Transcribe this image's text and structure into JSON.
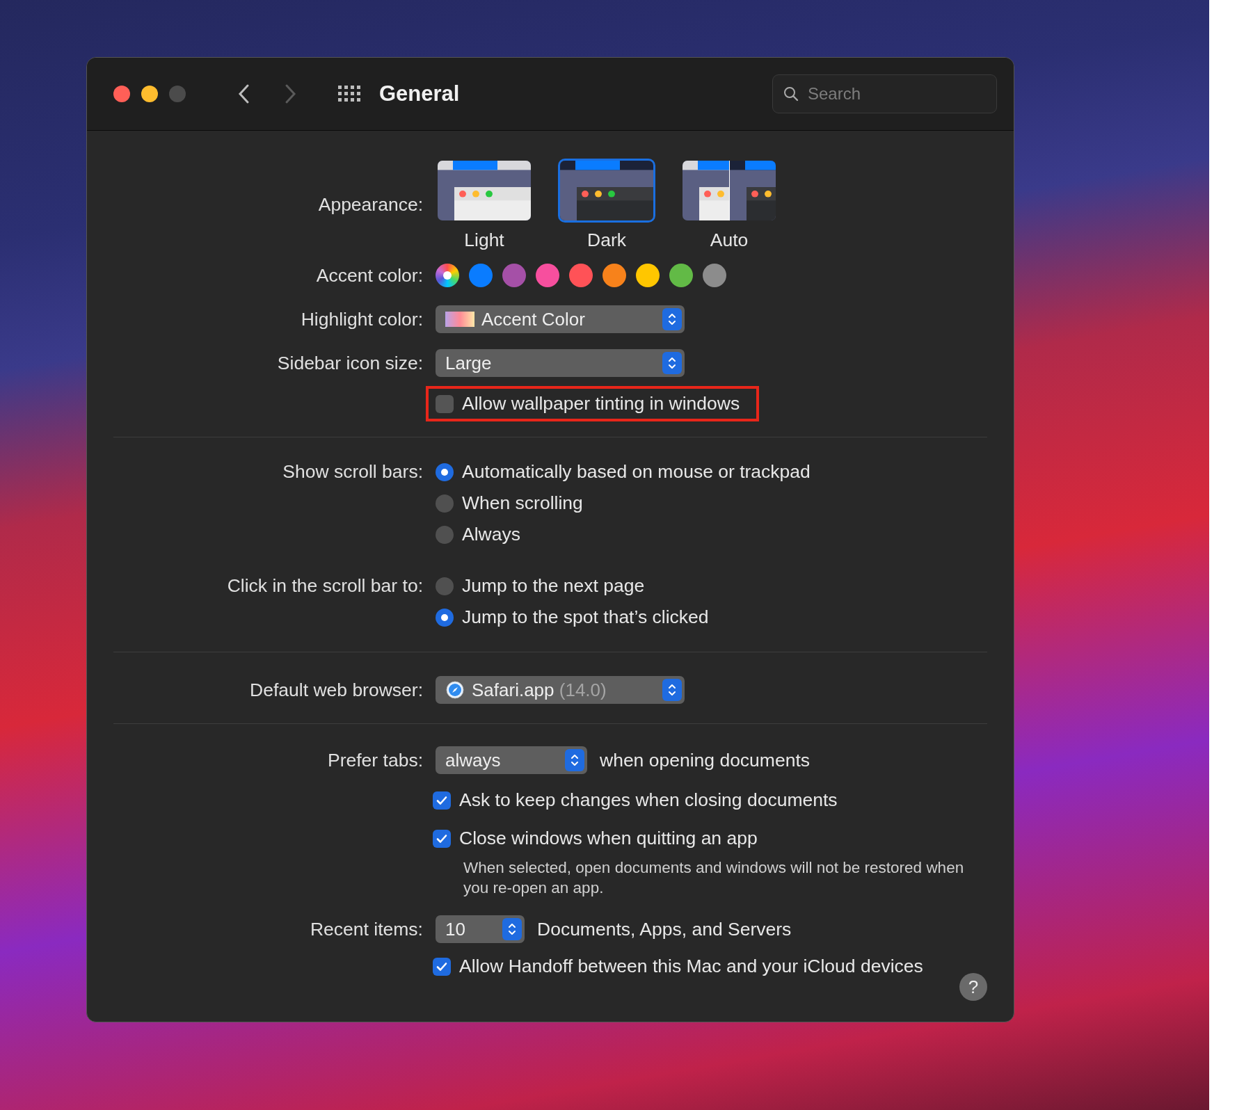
{
  "window": {
    "title": "General",
    "search": {
      "placeholder": "Search"
    },
    "forward_disabled": true
  },
  "appearance": {
    "label": "Appearance:",
    "options": [
      {
        "label": "Light",
        "kind": "light",
        "selected": false
      },
      {
        "label": "Dark",
        "kind": "dark",
        "selected": true
      },
      {
        "label": "Auto",
        "kind": "auto",
        "selected": false
      }
    ]
  },
  "accent_color": {
    "label": "Accent color:",
    "colors": [
      {
        "kind": "multicolor",
        "selected": true
      },
      {
        "kind": "solid",
        "color": "#0a7cff",
        "selected": false
      },
      {
        "kind": "solid",
        "color": "#a550a7",
        "selected": false
      },
      {
        "kind": "solid",
        "color": "#f74f9e",
        "selected": false
      },
      {
        "kind": "solid",
        "color": "#ff5257",
        "selected": false
      },
      {
        "kind": "solid",
        "color": "#f7821b",
        "selected": false
      },
      {
        "kind": "solid",
        "color": "#ffc600",
        "selected": false
      },
      {
        "kind": "solid",
        "color": "#62ba46",
        "selected": false
      },
      {
        "kind": "solid",
        "color": "#8c8c8c",
        "selected": false
      }
    ]
  },
  "highlight_color": {
    "label": "Highlight color:",
    "value": "Accent Color"
  },
  "sidebar_icon_size": {
    "label": "Sidebar icon size:",
    "value": "Large"
  },
  "wallpaper_tinting": {
    "label": "Allow wallpaper tinting in windows",
    "checked": false,
    "annotated": true
  },
  "scroll_bars": {
    "label": "Show scroll bars:",
    "options": [
      {
        "label": "Automatically based on mouse or trackpad",
        "selected": true
      },
      {
        "label": "When scrolling",
        "selected": false
      },
      {
        "label": "Always",
        "selected": false
      }
    ]
  },
  "click_scroll_bar": {
    "label": "Click in the scroll bar to:",
    "options": [
      {
        "label": "Jump to the next page",
        "selected": false
      },
      {
        "label": "Jump to the spot that’s clicked",
        "selected": true
      }
    ]
  },
  "default_browser": {
    "label": "Default web browser:",
    "app": "Safari.app",
    "version": "(14.0)"
  },
  "prefer_tabs": {
    "label": "Prefer tabs:",
    "value": "always",
    "suffix": "when opening documents"
  },
  "ask_keep_changes": {
    "label": "Ask to keep changes when closing documents",
    "checked": true
  },
  "close_windows": {
    "label": "Close windows when quitting an app",
    "checked": true,
    "note": "When selected, open documents and windows will not be restored when you re-open an app."
  },
  "recent_items": {
    "label": "Recent items:",
    "value": "10",
    "suffix": "Documents, Apps, and Servers"
  },
  "handoff": {
    "label": "Allow Handoff between this Mac and your iCloud devices",
    "checked": true
  },
  "help": {
    "label": "?"
  }
}
